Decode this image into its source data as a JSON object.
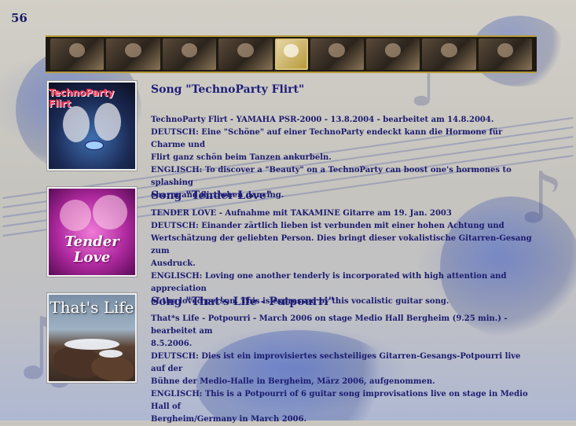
{
  "page": {
    "number": "56"
  },
  "filmstrip": {
    "frame_count": 9,
    "accent_color": "#b79a3a"
  },
  "songs": [
    {
      "cover_title": "TechnoParty Flirt",
      "cover_colors": [
        "#3f6fb0",
        "#1b2a55"
      ],
      "heading": "Song \"TechnoParty Flirt\"",
      "lines": [
        "TechnoParty Flirt - YAMAHA PSR-2000 - 13.8.2004 - bearbeitet am 14.8.2004.",
        "DEUTSCH: Eine \"Schöne\" auf einer TechnoParty endeckt kann die Hormone für Charme und",
        "Flirt ganz schön beim Tanzen ankurbeln.",
        "ENGLISCH: To discover a \"Beauty\" on a TechnoParty can boost one's hormones to splashing",
        "charm and flirt when dancing."
      ]
    },
    {
      "cover_title": "Tender Love",
      "cover_colors": [
        "#f07bd8",
        "#b02aa0"
      ],
      "heading": "Song \"Tender Love\"",
      "lines": [
        "TENDER LOVE - Aufnahme mit TAKAMINE Gitarre am 19. Jan. 2003",
        "DEUTSCH: Einander zärtlich lieben ist verbunden mit einer hohen Achtung und",
        "Wertschätzung der geliebten Person. Dies bringt dieser vokalistische Gitarren-Gesang zum",
        "Ausdruck.",
        "ENGLISCH: Loving one another tenderly is incorporated with high attention and appreciation",
        "of the loved person. This is expressed by this vocalistic guitar song."
      ]
    },
    {
      "cover_title": "That's Life",
      "cover_colors": [
        "#7a8fa6",
        "#3a2b22"
      ],
      "heading": "Song \"That's Life - Potpourri\"",
      "lines": [
        "That*s Life - Potpourri - March 2006 on stage Medio Hall Bergheim (9.25 min.) - bearbeitet am",
        "8.5.2006.",
        "DEUTSCH: Dies ist ein improvisiertes sechsteiliges Gitarren-Gesangs-Potpourri live auf der",
        "Bühne der Medio-Halle in Bergheim, März 2006, aufgenommen.",
        "ENGLISCH: This is a Potpourri of 6 guitar song improvisations live on stage in Medio Hall of",
        "Bergheim/Germany in March 2006."
      ]
    }
  ],
  "colors": {
    "text": "#1b1b6e",
    "heading": "#1e1e7a",
    "page_number": "#1a1a66"
  }
}
